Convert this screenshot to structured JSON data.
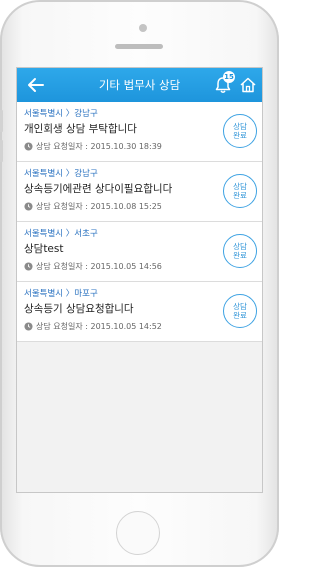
{
  "header": {
    "title": "기타 법무사 상담",
    "notification_count": "15"
  },
  "consultations": [
    {
      "region": "서울특별시 〉강남구",
      "subject": "개인회생 상담 부탁합니다",
      "request_date": "상담 요청일자 : 2015.10.30 18:39",
      "status_line1": "상담",
      "status_line2": "완료"
    },
    {
      "region": "서울특별시 〉강남구",
      "subject": "상속등기에관련 상다이필요합니다",
      "request_date": "상담 요청일자 : 2015.10.08 15:25",
      "status_line1": "상담",
      "status_line2": "완료"
    },
    {
      "region": "서울특별시 〉서초구",
      "subject": "상담test",
      "request_date": "상담 요청일자 : 2015.10.05 14:56",
      "status_line1": "상담",
      "status_line2": "완료"
    },
    {
      "region": "서울특별시 〉마포구",
      "subject": "상속등기 상담요청합니다",
      "request_date": "상담 요청일자 : 2015.10.05 14:52",
      "status_line1": "상담",
      "status_line2": "완료"
    }
  ],
  "colors": {
    "header": "#1e95dc",
    "region_text": "#2a72c0",
    "status_ring": "#3fa3e3"
  }
}
